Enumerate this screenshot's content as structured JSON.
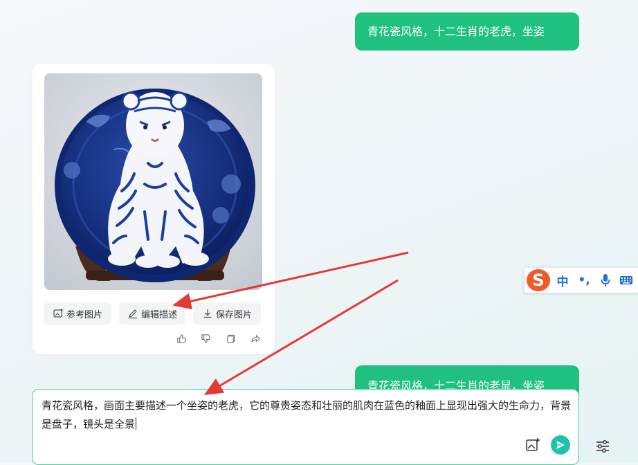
{
  "chat": {
    "user_message_1": "青花瓷风格，十二生肖的老虎，坐姿",
    "user_message_2": "青花瓷风格，十二生肖的老鼠，坐姿"
  },
  "result_card": {
    "image_alt": "青花瓷老虎坐姿",
    "actions": {
      "reference_image": "参考图片",
      "edit_description": "编辑描述",
      "save_image": "保存图片"
    },
    "feedback_icons": [
      "thumbs-up-icon",
      "thumbs-down-icon",
      "copy-icon",
      "share-icon"
    ]
  },
  "composer": {
    "text": "青花瓷风格，画面主要描述一个坐姿的老虎，它的尊贵姿态和壮丽的肌肉在蓝色的釉面上显现出强大的生命力，背景是盘子，镜头是全景"
  },
  "ime_toolbar": {
    "mode": "中",
    "punct": "•,"
  },
  "colors": {
    "accent": "#20c07f",
    "annotation_arrow": "#e53935",
    "ime_brand": "#f05a28"
  }
}
